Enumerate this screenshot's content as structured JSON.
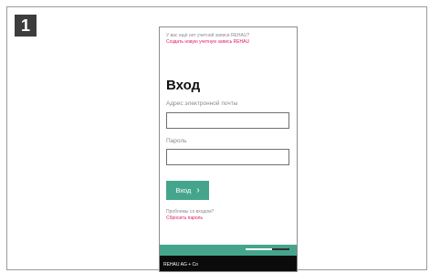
{
  "step": {
    "number": "1"
  },
  "login": {
    "no_account_text": "У вас ещё нет учетной записи REHAU?",
    "create_account_link": "Создать новую учетную запись REHAU",
    "title": "Вход",
    "email_label": "Адрес электронной почты",
    "email_value": "",
    "password_label": "Пароль",
    "password_value": "",
    "submit_label": "Вход",
    "problems_text": "Проблемы со входом?",
    "reset_link": "Сбросить пароль"
  },
  "scroll_indicator": {
    "position_fraction": 0.6
  },
  "footer": {
    "text": "REHAU AG + Co"
  },
  "colors": {
    "accent": "#45a58c",
    "link": "#e3126b",
    "footer_bg": "#0b0b0b"
  },
  "icons": {
    "submit": "chevron-right-icon"
  }
}
